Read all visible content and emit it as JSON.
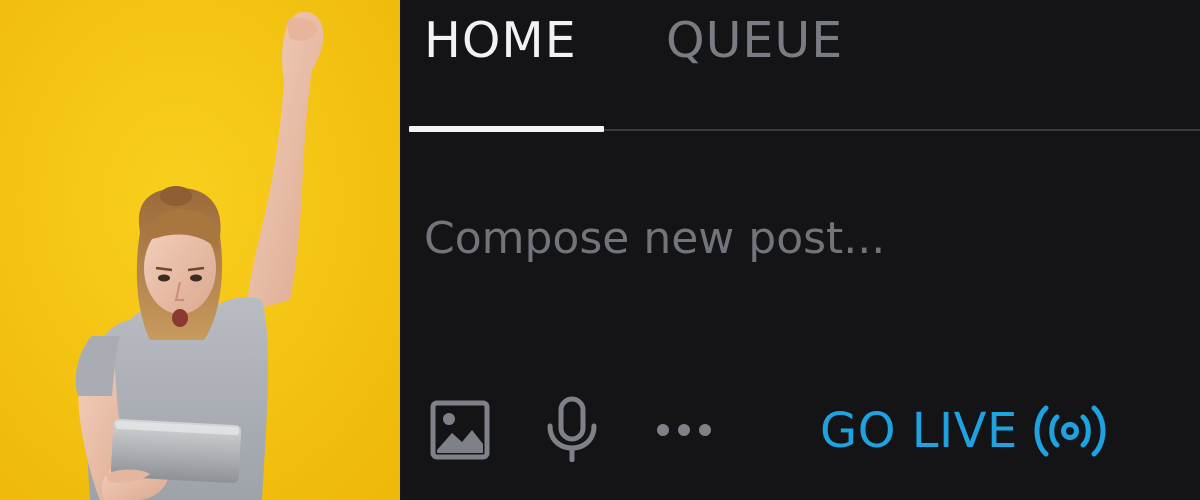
{
  "photo": {
    "subject": "woman-cheering-with-tablet",
    "background_color": "#f6c60f"
  },
  "tabs": [
    {
      "label": "HOME",
      "active": true
    },
    {
      "label": "QUEUE",
      "active": false
    }
  ],
  "composer": {
    "placeholder": "Compose new post...",
    "value": ""
  },
  "toolbar": {
    "image_icon": "image-icon",
    "mic_icon": "microphone-icon",
    "more_icon": "more-horizontal-icon",
    "go_live_label": "GO LIVE",
    "go_live_icon": "broadcast-icon"
  },
  "colors": {
    "background": "#141417",
    "accent": "#1ea3e0",
    "tab_active": "#f2f2f4",
    "tab_inactive": "#7a7c84",
    "icon": "#7f8189"
  }
}
